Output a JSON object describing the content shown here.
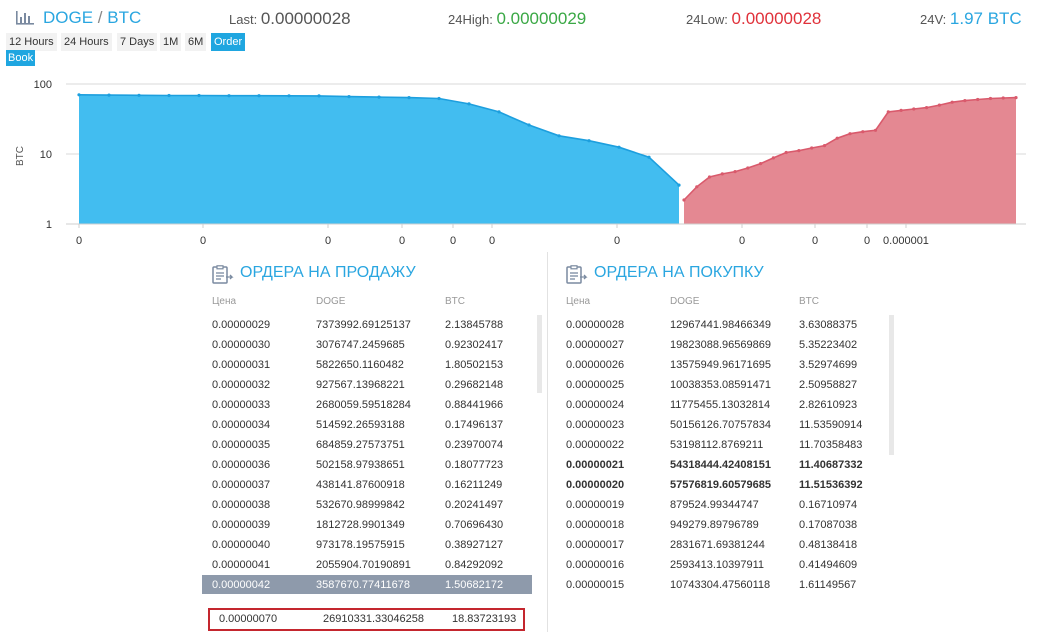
{
  "header": {
    "base": "DOGE",
    "separator": "/",
    "quote": "BTC",
    "last_label": "Last:",
    "last_value": "0.00000028",
    "high_label": "24High:",
    "high_value": "0.00000029",
    "low_label": "24Low:",
    "low_value": "0.00000028",
    "volume_label": "24V:",
    "volume_value": "1.97 BTC"
  },
  "range_tabs": [
    "12 Hours",
    "24 Hours",
    "7 Days",
    "1M",
    "6M",
    "Order"
  ],
  "active_tab": "Order",
  "book_tab": "Book",
  "colors": {
    "accent": "#1fa6e0",
    "bid_fill": "#42bdf0",
    "ask_fill": "#e48892",
    "ask_line": "#d95a6c",
    "bid_line": "#1d9fde",
    "up": "#3aa845",
    "down": "#e0313a"
  },
  "icons": {
    "header": "bar-chart-icon",
    "sell": "document-list-icon",
    "buy": "document-list-icon"
  },
  "chart_data": {
    "type": "area",
    "ylabel": "BTC",
    "yscale": "log",
    "ylim": [
      1,
      100
    ],
    "yticks": [
      "1",
      "10",
      "100"
    ],
    "xticks": [
      "0",
      "0",
      "0",
      "0",
      "0",
      "0",
      "0",
      "0",
      "0",
      "0",
      "0.000001"
    ],
    "series": [
      {
        "side": "bid",
        "values": [
          70,
          69.5,
          69,
          68.5,
          68.5,
          68,
          68,
          67.8,
          67.5,
          66,
          65,
          64,
          62,
          52,
          40,
          26,
          18.2,
          15.5,
          12.5,
          9,
          3.6
        ]
      },
      {
        "side": "ask",
        "values": [
          2.2,
          3.4,
          4.7,
          5.2,
          5.6,
          6.3,
          7.3,
          8.8,
          10.5,
          11.2,
          12.2,
          13.2,
          16.8,
          19.5,
          20.8,
          21.8,
          40,
          42,
          44,
          46,
          50,
          55,
          58,
          60,
          62,
          63,
          64
        ]
      }
    ]
  },
  "sell": {
    "title": "ОРДЕРА НА ПРОДАЖУ",
    "headers": [
      "Цена",
      "DOGE",
      "BTC"
    ],
    "rows": [
      [
        "0.00000029",
        "7373992.69125137",
        "2.13845788"
      ],
      [
        "0.00000030",
        "3076747.2459685",
        "0.92302417"
      ],
      [
        "0.00000031",
        "5822650.1160482",
        "1.80502153"
      ],
      [
        "0.00000032",
        "927567.13968221",
        "0.29682148"
      ],
      [
        "0.00000033",
        "2680059.59518284",
        "0.88441966"
      ],
      [
        "0.00000034",
        "514592.26593188",
        "0.17496137"
      ],
      [
        "0.00000035",
        "684859.27573751",
        "0.23970074"
      ],
      [
        "0.00000036",
        "502158.97938651",
        "0.18077723"
      ],
      [
        "0.00000037",
        "438141.87600918",
        "0.16211249"
      ],
      [
        "0.00000038",
        "532670.98999842",
        "0.20241497"
      ],
      [
        "0.00000039",
        "1812728.9901349",
        "0.70696430"
      ],
      [
        "0.00000040",
        "973178.19575915",
        "0.38927127"
      ],
      [
        "0.00000041",
        "2055904.70190891",
        "0.84292092"
      ],
      [
        "0.00000042",
        "3587670.77411678",
        "1.50682172"
      ]
    ],
    "summary": [
      "0.00000070",
      "26910331.33046258",
      "18.83723193"
    ]
  },
  "buy": {
    "title": "ОРДЕРА НА ПОКУПКУ",
    "headers": [
      "Цена",
      "DOGE",
      "BTC"
    ],
    "rows": [
      [
        "0.00000028",
        "12967441.98466349",
        "3.63088375"
      ],
      [
        "0.00000027",
        "19823088.96569869",
        "5.35223402"
      ],
      [
        "0.00000026",
        "13575949.96171695",
        "3.52974699"
      ],
      [
        "0.00000025",
        "10038353.08591471",
        "2.50958827"
      ],
      [
        "0.00000024",
        "11775455.13032814",
        "2.82610923"
      ],
      [
        "0.00000023",
        "50156126.70757834",
        "11.53590914"
      ],
      [
        "0.00000022",
        "53198112.8769211",
        "11.70358483"
      ],
      [
        "0.00000021",
        "54318444.42408151",
        "11.40687332"
      ],
      [
        "0.00000020",
        "57576819.60579685",
        "11.51536392"
      ],
      [
        "0.00000019",
        "879524.99344747",
        "0.16710974"
      ],
      [
        "0.00000018",
        "949279.89796789",
        "0.17087038"
      ],
      [
        "0.00000017",
        "2831671.69381244",
        "0.48138418"
      ],
      [
        "0.00000016",
        "2593413.10397911",
        "0.41494609"
      ],
      [
        "0.00000015",
        "10743304.47560118",
        "1.61149567"
      ]
    ]
  }
}
